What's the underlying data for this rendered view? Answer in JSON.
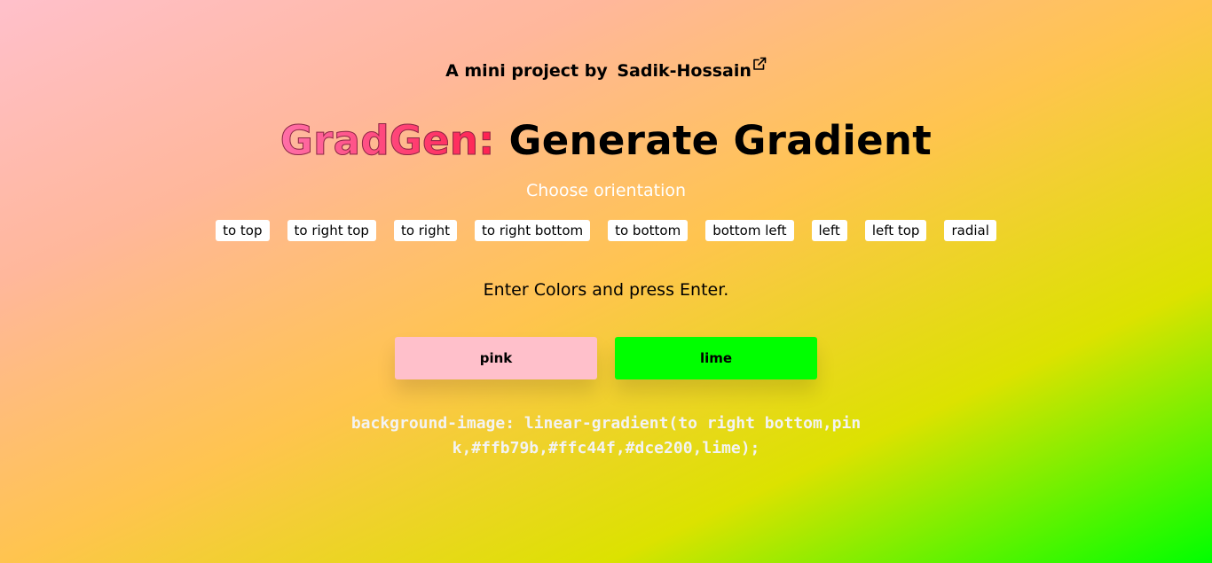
{
  "header": {
    "byline_prefix": "A mini project by",
    "author": "Sadik-Hossain",
    "author_icon": "external-link-icon"
  },
  "title": {
    "brand": "GradGen:",
    "text": "Generate Gradient"
  },
  "orientation": {
    "label": "Choose orientation",
    "options": [
      "to top",
      "to right top",
      "to right",
      "to right bottom",
      "to bottom",
      "bottom left",
      "left",
      "left top",
      "radial"
    ]
  },
  "colors": {
    "instruction": "Enter Colors and press Enter.",
    "inputs": [
      {
        "value": "pink",
        "background": "#ffc0cb"
      },
      {
        "value": "lime",
        "background": "#00ff00"
      }
    ]
  },
  "output": {
    "css": "background-image: linear-gradient(to right bottom,pink,#ffb79b,#ffc44f,#dce200,lime);"
  },
  "theme": {
    "brand_gradient_start": "#ff6fa8",
    "brand_gradient_end": "#ff2050",
    "code_text": "#f3f3f3"
  }
}
